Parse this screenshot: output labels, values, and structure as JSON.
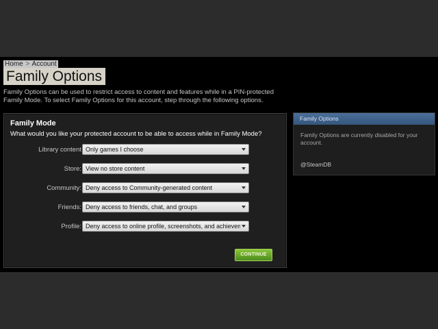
{
  "breadcrumb": {
    "home": "Home",
    "separator": ">",
    "account": "Account"
  },
  "page_title": "Family Options",
  "intro_text": "Family Options can be used to restrict access to content and features while in a PIN-protected Family Mode. To select Family Options for this account, step through the following options.",
  "family_mode": {
    "heading": "Family Mode",
    "question": "What would you like your protected account to be able to access while in Family Mode?",
    "rows": [
      {
        "label": "Library content",
        "value": "Only games I choose"
      },
      {
        "label": "Store:",
        "value": "View no store content"
      },
      {
        "label": "Community:",
        "value": "Deny access to Community-generated content"
      },
      {
        "label": "Friends:",
        "value": "Deny access to friends, chat, and groups"
      },
      {
        "label": "Profile:",
        "value": "Deny access to online profile, screenshots, and achievem"
      }
    ],
    "continue_label": "CONTINUE"
  },
  "side_panel": {
    "title": "Family Options",
    "status_text": "Family Options are currently disabled for your account.",
    "username": "@SteamDB"
  },
  "colors": {
    "background": "#000000",
    "panel": "#1f1f1f",
    "side_header": "#4b6f9a",
    "continue_button": "#6aa82a"
  },
  "icons": {
    "select_arrow": "chevron-down-icon"
  }
}
